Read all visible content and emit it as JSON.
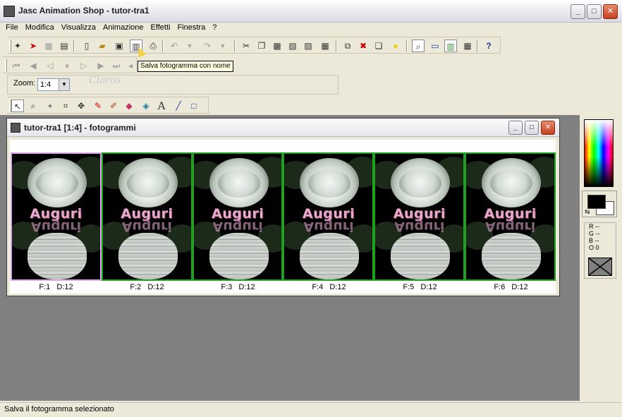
{
  "window": {
    "title": "Jasc Animation Shop - tutor-tra1",
    "controls": {
      "minimize": "_",
      "maximize": "□",
      "close": "✕"
    }
  },
  "menu": [
    "File",
    "Modifica",
    "Visualizza",
    "Animazione",
    "Effetti",
    "Finestra",
    "?"
  ],
  "tooltip": "Salva fotogramma con nome",
  "zoom": {
    "label": "Zoom:",
    "value": "1:4"
  },
  "watermark": "Claros",
  "icons": {
    "main_toolbar": [
      "wizard-icon",
      "banner-icon",
      "grid-icon",
      "film-icon",
      "new-icon",
      "open-icon",
      "save-icon",
      "save-frame-icon",
      "print-icon",
      "undo-icon",
      "undo-dropdown-icon",
      "redo-icon",
      "redo-dropdown-icon",
      "cut-icon",
      "copy-icon",
      "copy-frame-icon",
      "paste-icon",
      "paste-frame-icon",
      "paste-new-icon",
      "insert-frame-icon",
      "delete-frame-icon",
      "duplicate-icon",
      "bulb-icon",
      "zoom-view-icon",
      "filmstrip-icon",
      "colors-icon",
      "frames-grid-icon",
      "help-context-icon"
    ],
    "playback": [
      "first-frame-icon",
      "prev-frame-icon",
      "step-back-icon",
      "pause-icon",
      "step-forward-icon",
      "next-frame-icon",
      "last-frame-icon",
      "play-icon"
    ],
    "tools": [
      "arrow-tool-icon",
      "zoom-tool-icon",
      "crosshair-tool-icon",
      "crop-tool-icon",
      "move-tool-icon",
      "dropper-tool-icon",
      "brush-tool-icon",
      "eraser-tool-icon",
      "fill-tool-icon",
      "text-tool-icon",
      "line-tool-icon",
      "rectangle-tool-icon"
    ]
  },
  "document": {
    "title": "tutor-tra1 [1:4] - fotogrammi",
    "frames": [
      {
        "frame": "F:1",
        "delay": "D:12",
        "text": "Auguri"
      },
      {
        "frame": "F:2",
        "delay": "D:12",
        "text": "Auguri"
      },
      {
        "frame": "F:3",
        "delay": "D:12",
        "text": "Auguri"
      },
      {
        "frame": "F:4",
        "delay": "D:12",
        "text": "Auguri"
      },
      {
        "frame": "F:5",
        "delay": "D:12",
        "text": "Auguri"
      },
      {
        "frame": "F:6",
        "delay": "D:12",
        "text": "Auguri"
      }
    ]
  },
  "palette": {
    "foreground": "#000000",
    "background": "#ffffff",
    "rgbo": [
      "R --",
      "G --",
      "B --",
      "O 0"
    ]
  },
  "status": "Salva il fotogramma selezionato",
  "colors": {
    "frame_border": "#1ea21e",
    "selected_frame_border": "#d9a6e8",
    "workspace": "#808080",
    "tooltip_bg": "#ffffe1"
  }
}
